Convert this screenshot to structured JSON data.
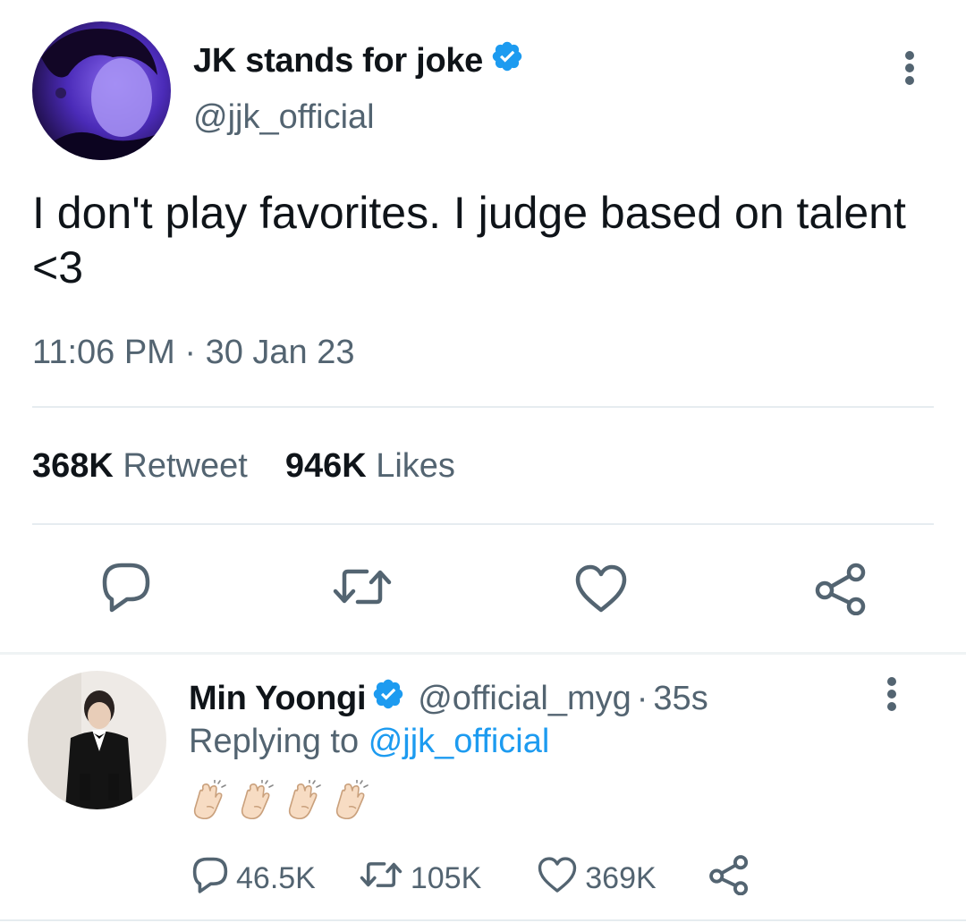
{
  "tweet": {
    "display_name": "JK stands for joke",
    "handle": "@jjk_official",
    "text": "I don't play favorites. I judge based on talent <3",
    "timestamp": "11:06 PM · 30 Jan 23",
    "retweet_count": "368K",
    "retweet_label": "Retweet",
    "like_count": "946K",
    "like_label": "Likes",
    "avatar_icon": "profile-photo",
    "actions": [
      "reply-icon",
      "retweet-icon",
      "like-icon",
      "share-icon"
    ]
  },
  "reply": {
    "display_name": "Min Yoongi",
    "handle": "@official_myg",
    "separator": "·",
    "time": "35s",
    "replying_prefix": "Replying to",
    "replying_to": "@jjk_official",
    "claps": [
      "clapping-hands-emoji",
      "clapping-hands-emoji",
      "clapping-hands-emoji",
      "clapping-hands-emoji"
    ],
    "reply_count": "46.5K",
    "retweet_count": "105K",
    "like_count": "369K"
  },
  "colors": {
    "verified": "#1d9bf0",
    "secondary_text": "#536471",
    "mention": "#1d9bf0",
    "divider": "#e6ecf0"
  }
}
